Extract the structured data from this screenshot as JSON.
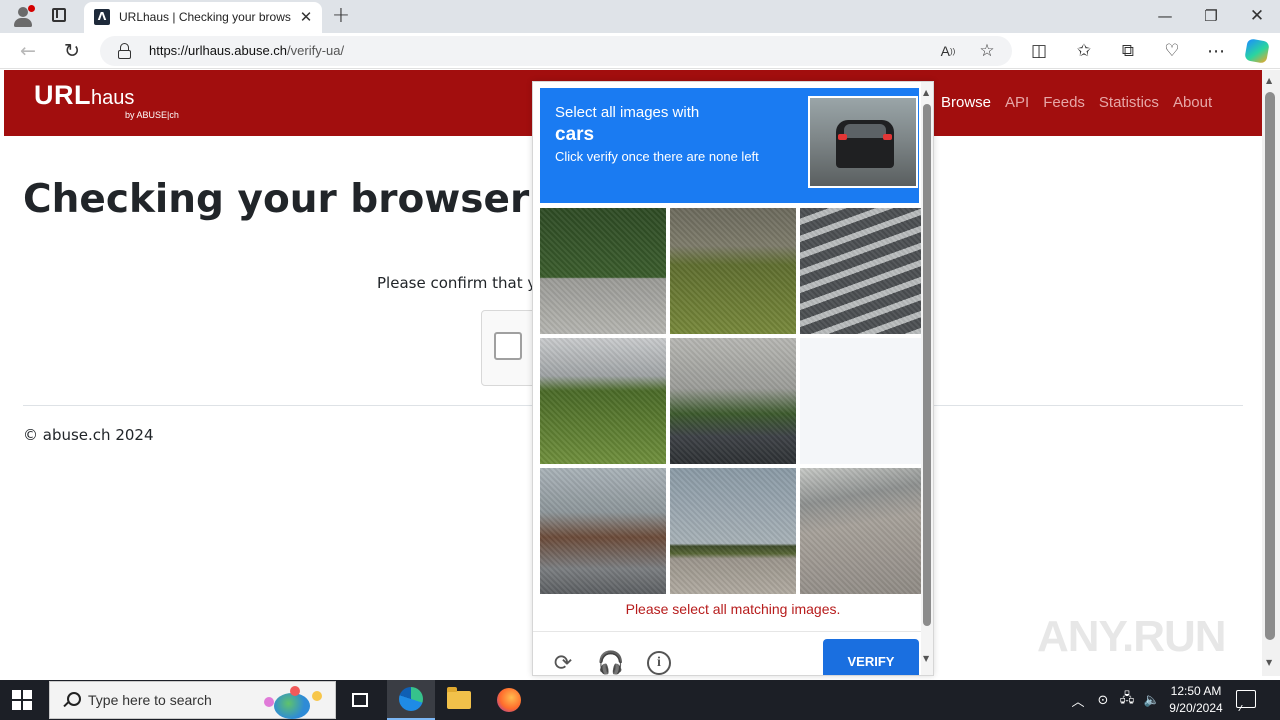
{
  "browser": {
    "tab_title": "URLhaus | Checking your browser",
    "tab_favicon": "Λ",
    "url_host": "https://urlhaus.abuse.ch",
    "url_path": "/verify-ua/",
    "read_aloud_label": "Ȃ",
    "icons": [
      "profile-icon",
      "tab-actions-icon",
      "close-icon",
      "plus-icon",
      "minimize-icon",
      "restore-icon",
      "close-window-icon",
      "back-icon",
      "reload-icon",
      "lock-icon",
      "read-aloud-icon",
      "star-icon",
      "split-screen-icon",
      "favorites-icon",
      "collections-icon",
      "browser-essentials-icon",
      "more-icon",
      "copilot-icon"
    ]
  },
  "site": {
    "logo_main": "URL",
    "logo_sub": "haus",
    "logo_by": "by ABUSE|ch",
    "nav": {
      "browse": "Browse",
      "api": "API",
      "feeds": "Feeds",
      "statistics": "Statistics",
      "about": "About"
    },
    "brand_color": "#a20e0e"
  },
  "main": {
    "title": "Checking your browser",
    "confirm_text": "Please confirm that you",
    "footer": "© abuse.ch 2024"
  },
  "captcha": {
    "prompt_line1": "Select all images with",
    "prompt_target": "cars",
    "prompt_line3": "Click verify once there are none left",
    "error": "Please select all matching images.",
    "verify_label": "VERIFY",
    "accent": "#1a7bf2",
    "tile_count": 9,
    "icons": [
      "refresh-icon",
      "headphones-icon",
      "info-icon"
    ]
  },
  "taskbar": {
    "search_placeholder": "Type here to search",
    "time": "12:50 AM",
    "date": "9/20/2024",
    "icons": [
      "start-icon",
      "search-icon",
      "task-view-icon",
      "edge-icon",
      "file-explorer-icon",
      "firefox-icon",
      "tray-chevron-icon",
      "network-icon",
      "volume-icon",
      "notification-icon"
    ]
  },
  "watermark": "ANY.RUN"
}
